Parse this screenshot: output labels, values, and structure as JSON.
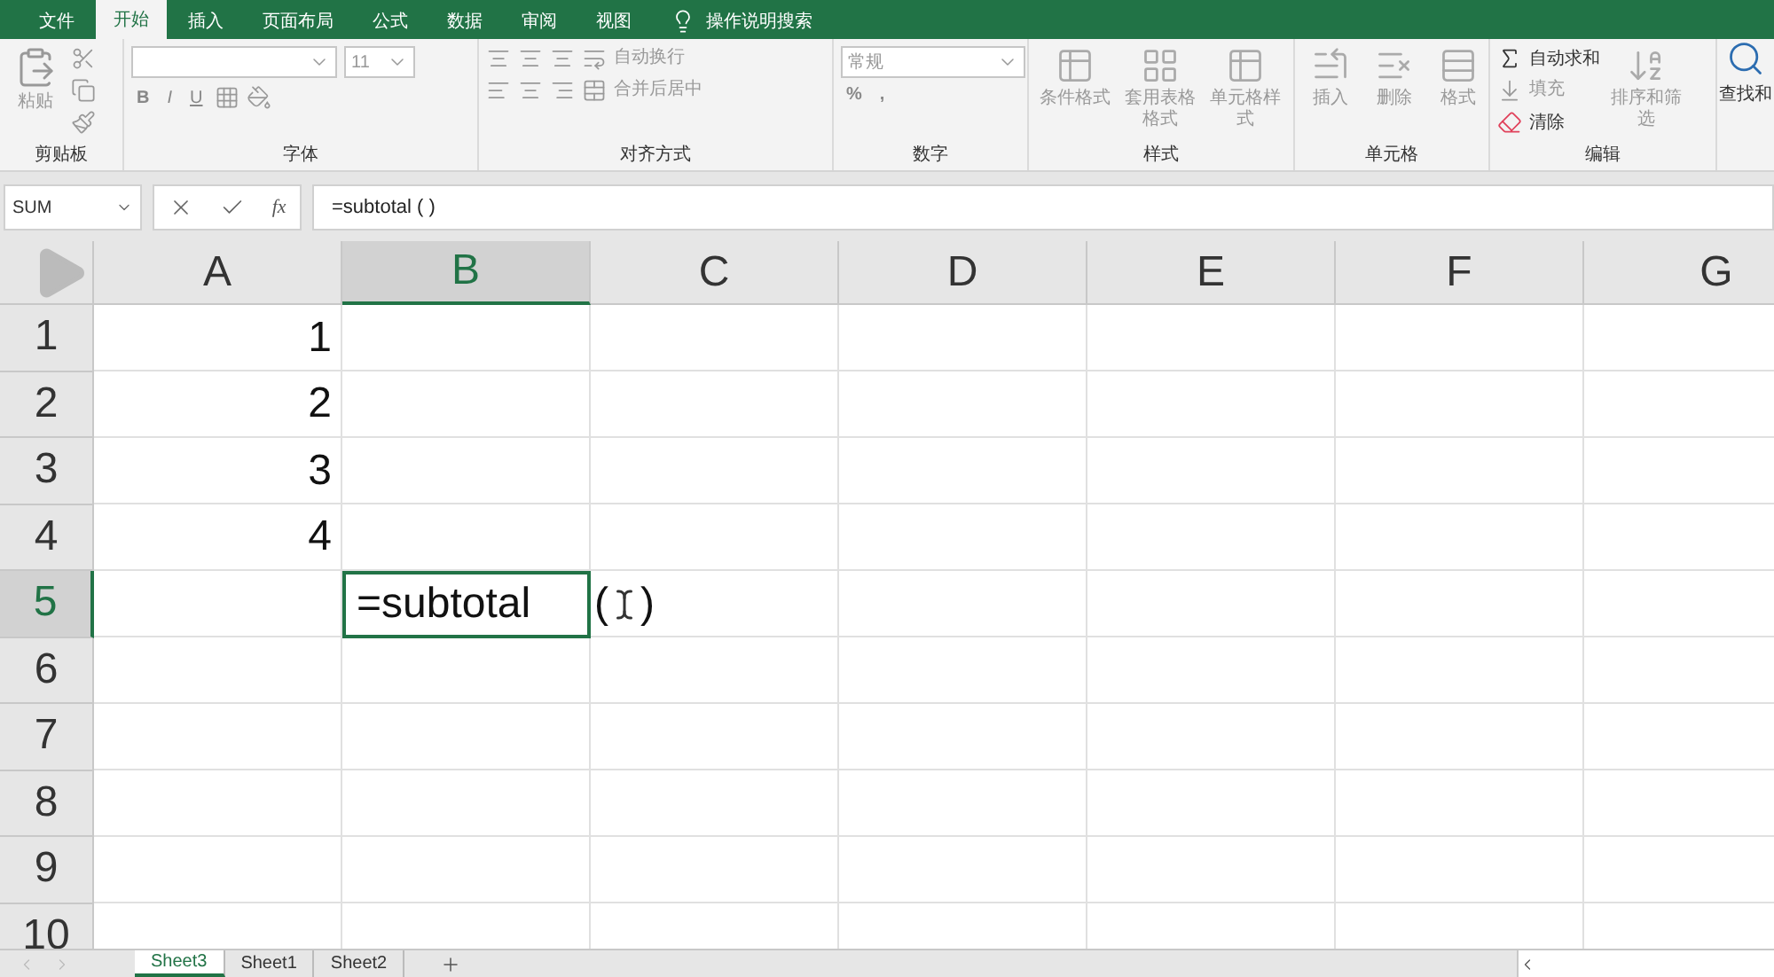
{
  "menu_tabs": [
    {
      "label": "文件",
      "selected": false
    },
    {
      "label": "开始",
      "selected": true
    },
    {
      "label": "插入",
      "selected": false
    },
    {
      "label": "页面布局",
      "selected": false
    },
    {
      "label": "公式",
      "selected": false
    },
    {
      "label": "数据",
      "selected": false
    },
    {
      "label": "审阅",
      "selected": false
    },
    {
      "label": "视图",
      "selected": false
    }
  ],
  "tell_me": "操作说明搜索",
  "ribbon": {
    "clipboard": {
      "paste": "粘贴",
      "label": "剪贴板"
    },
    "font": {
      "size": "11",
      "styles": [
        "B",
        "I",
        "U"
      ],
      "label": "字体"
    },
    "alignment": {
      "wrap": "自动换行",
      "merge": "合并后居中",
      "label": "对齐方式"
    },
    "number": {
      "format": "常规",
      "percent": "%",
      "comma": ",",
      "label": "数字"
    },
    "styles": {
      "buttons": [
        "条件格式",
        "套用表格格式",
        "单元格样式"
      ],
      "label": "样式"
    },
    "cells": {
      "buttons": [
        "插入",
        "删除",
        "格式"
      ],
      "label": "单元格"
    },
    "editing": {
      "autosum": "自动求和",
      "fill": "填充",
      "clear": "清除",
      "sort": "排序和筛选",
      "label": "编辑"
    },
    "find": "查找和"
  },
  "formula_bar": {
    "name_box": "SUM",
    "fx": "fx",
    "formula": "=subtotal ( )"
  },
  "columns": [
    {
      "label": "A",
      "selected": false
    },
    {
      "label": "B",
      "selected": true
    },
    {
      "label": "C",
      "selected": false
    },
    {
      "label": "D",
      "selected": false
    },
    {
      "label": "E",
      "selected": false
    },
    {
      "label": "F",
      "selected": false
    },
    {
      "label": "G",
      "selected": false
    }
  ],
  "rows": [
    {
      "label": "1",
      "selected": false,
      "cells": [
        "1"
      ]
    },
    {
      "label": "2",
      "selected": false,
      "cells": [
        "2"
      ]
    },
    {
      "label": "3",
      "selected": false,
      "cells": [
        "3"
      ]
    },
    {
      "label": "4",
      "selected": false,
      "cells": [
        "4"
      ]
    },
    {
      "label": "5",
      "selected": true,
      "cells": [
        "",
        "=subtotal"
      ],
      "editor_tail": [
        "(",
        ")"
      ]
    },
    {
      "label": "6",
      "selected": false,
      "cells": []
    },
    {
      "label": "7",
      "selected": false,
      "cells": []
    },
    {
      "label": "8",
      "selected": false,
      "cells": []
    },
    {
      "label": "9",
      "selected": false,
      "cells": []
    },
    {
      "label": "10",
      "selected": false,
      "cells": []
    }
  ],
  "sheets": [
    {
      "label": "Sheet3",
      "selected": true
    },
    {
      "label": "Sheet1",
      "selected": false
    },
    {
      "label": "Sheet2",
      "selected": false
    }
  ]
}
